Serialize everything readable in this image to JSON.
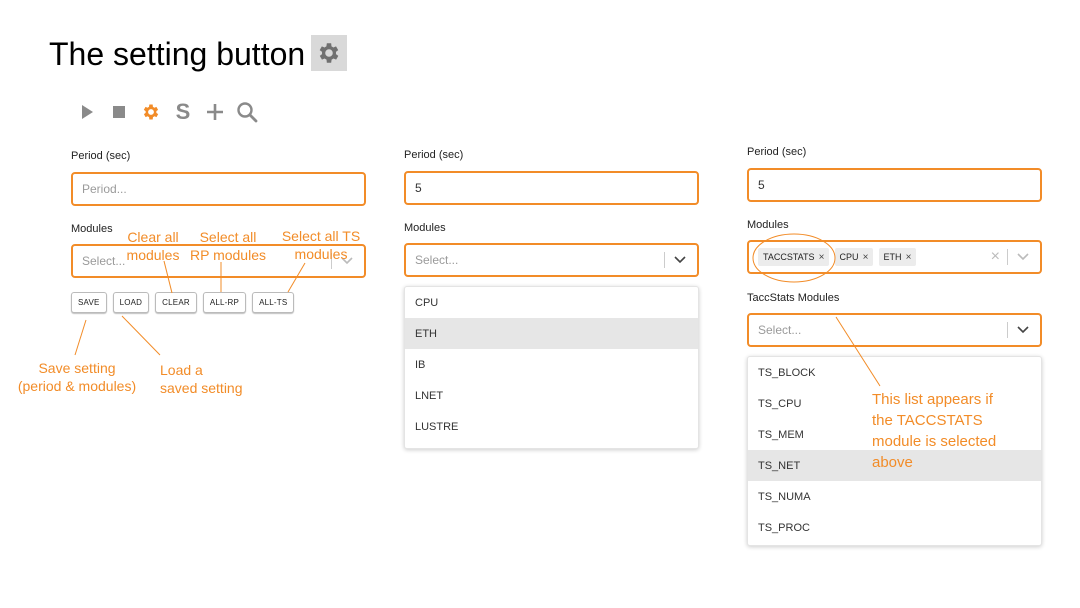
{
  "title": "The setting button",
  "colors": {
    "accent": "#f28c28",
    "icon_gray": "#8a8a8a",
    "hover": "#e6e6e6"
  },
  "toolbar": {
    "icons": [
      "play-icon",
      "stop-icon",
      "gear-icon",
      "s-icon",
      "plus-icon",
      "search-icon"
    ],
    "s_glyph": "S"
  },
  "panel1": {
    "period_label": "Period (sec)",
    "period_placeholder": "Period...",
    "modules_label": "Modules",
    "modules_placeholder": "Select...",
    "buttons": [
      "SAVE",
      "LOAD",
      "CLEAR",
      "ALL-RP",
      "ALL-TS"
    ]
  },
  "panel2": {
    "period_label": "Period (sec)",
    "period_value": "5",
    "modules_label": "Modules",
    "modules_placeholder": "Select...",
    "options": [
      "CPU",
      "ETH",
      "IB",
      "LNET",
      "LUSTRE"
    ],
    "highlighted": "ETH"
  },
  "panel3": {
    "period_label": "Period (sec)",
    "period_value": "5",
    "modules_label": "Modules",
    "chips": [
      "TACCSTATS",
      "CPU",
      "ETH"
    ],
    "taccstats_label": "TaccStats Modules",
    "taccstats_placeholder": "Select...",
    "options": [
      "TS_BLOCK",
      "TS_CPU",
      "TS_MEM",
      "TS_NET",
      "TS_NUMA",
      "TS_PROC"
    ],
    "highlighted": "TS_NET"
  },
  "annotations": {
    "clear_all": "Clear all\nmodules",
    "select_rp": "Select all\nRP modules",
    "select_ts": "Select all TS\nmodules",
    "save_setting": "Save setting\n(period & modules)",
    "load_setting": "Load a\nsaved setting",
    "list_note": "This list appears if\nthe TACCSTATS\nmodule is selected\nabove"
  }
}
